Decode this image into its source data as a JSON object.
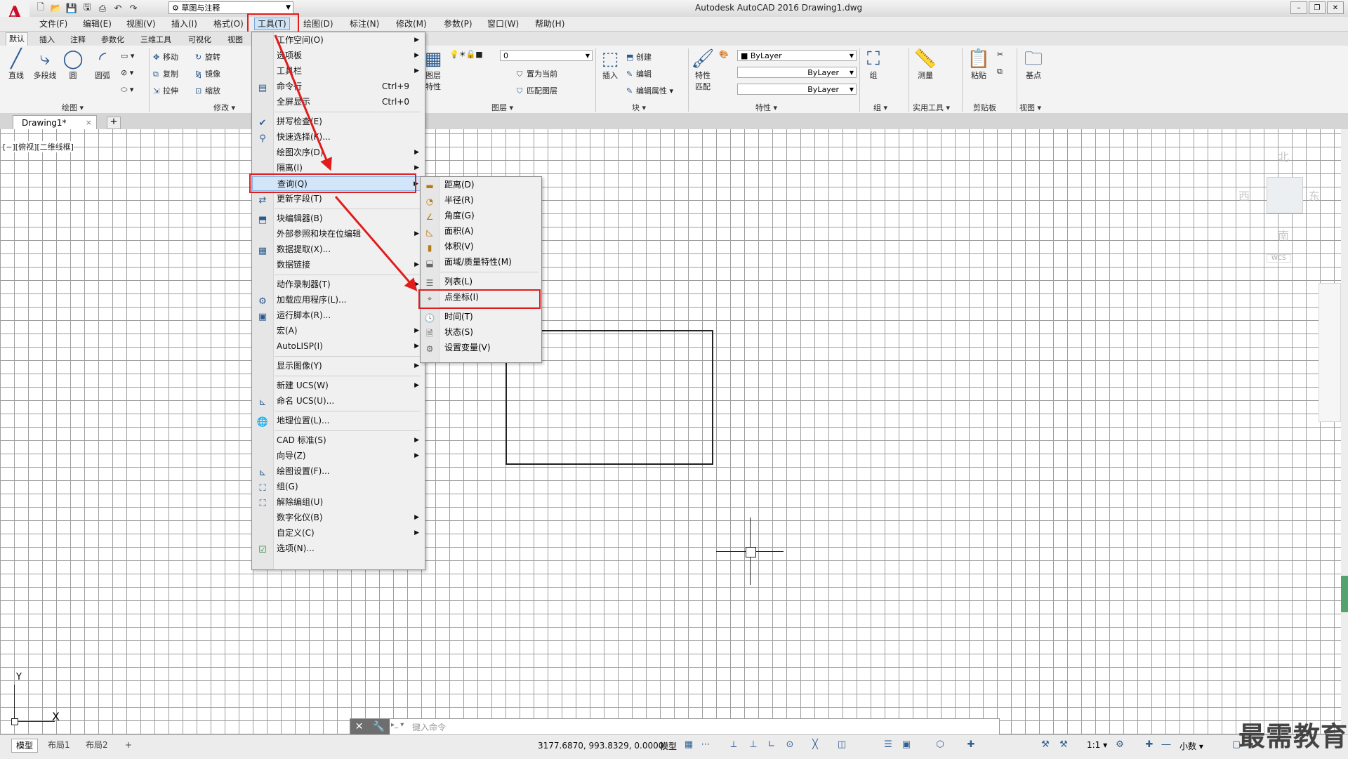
{
  "window": {
    "title": "Autodesk AutoCAD 2016    Drawing1.dwg",
    "logo": "A",
    "workspace": "草图与注释",
    "controls": [
      "–",
      "❐",
      "✕"
    ]
  },
  "qat": {
    "icons": [
      "new-icon",
      "open-icon",
      "save-icon",
      "saveas-icon",
      "print-icon",
      "undo-icon",
      "redo-icon"
    ]
  },
  "menubar": {
    "items": [
      "文件(F)",
      "编辑(E)",
      "视图(V)",
      "插入(I)",
      "格式(O)",
      "工具(T)",
      "绘图(D)",
      "标注(N)",
      "修改(M)",
      "参数(P)",
      "窗口(W)",
      "帮助(H)"
    ]
  },
  "ribbon": {
    "tabs": [
      "默认",
      "插入",
      "注释",
      "参数化",
      "三维工具",
      "可视化",
      "视图"
    ],
    "draw": {
      "line": "直线",
      "polyline": "多段线",
      "circle": "圆",
      "arc": "圆弧",
      "panel": "绘图"
    },
    "modify": {
      "move": "移动",
      "rotate": "旋转",
      "copy": "复制",
      "mirror": "镜像",
      "stretch": "拉伸",
      "scale": "缩放",
      "panel": "修改"
    },
    "layers": {
      "properties": "图层\n特性",
      "current_layer": "0",
      "set_current": "置为当前",
      "match_layer": "匹配图层",
      "panel": "图层"
    },
    "block": {
      "insert": "插入",
      "create": "创建",
      "edit": "编辑",
      "edit_attr": "编辑属性",
      "panel": "块"
    },
    "properties": {
      "match": "特性\n匹配",
      "color": "ByLayer",
      "linetype": "ByLayer",
      "lineweight": "ByLayer",
      "panel": "特性"
    },
    "groups": {
      "group": "组",
      "panel": "组"
    },
    "utilities": {
      "measure": "测量",
      "panel": "实用工具"
    },
    "clipboard": {
      "paste": "粘贴",
      "panel": "剪贴板"
    },
    "view": {
      "base": "基点",
      "panel": "视图"
    }
  },
  "doc_tab": {
    "name": "Drawing1*",
    "close": "×",
    "new": "+"
  },
  "viewport_label": "[−][俯视][二维线框]",
  "viewcube": {
    "north": "北",
    "south": "南",
    "east": "东",
    "west": "西",
    "wcs": "WCS"
  },
  "ucs": {
    "x": "X",
    "y": "Y"
  },
  "tools_menu": {
    "items": [
      {
        "label": "工作空间(O)",
        "submenu": true
      },
      {
        "label": "选项板",
        "submenu": true
      },
      {
        "label": "工具栏",
        "submenu": true
      },
      {
        "label": "命令行",
        "shortcut": "Ctrl+9"
      },
      {
        "label": "全屏显示",
        "shortcut": "Ctrl+0"
      },
      {
        "label": "拼写检查(E)"
      },
      {
        "label": "快速选择(K)..."
      },
      {
        "label": "绘图次序(D)",
        "submenu": true
      },
      {
        "label": "隔离(I)",
        "submenu": true
      },
      {
        "label": "查询(Q)",
        "submenu": true
      },
      {
        "label": "更新字段(T)"
      },
      {
        "label": "块编辑器(B)"
      },
      {
        "label": "外部参照和块在位编辑",
        "submenu": true
      },
      {
        "label": "数据提取(X)..."
      },
      {
        "label": "数据链接",
        "submenu": true
      },
      {
        "label": "动作录制器(T)",
        "submenu": true
      },
      {
        "label": "加载应用程序(L)..."
      },
      {
        "label": "运行脚本(R)..."
      },
      {
        "label": "宏(A)",
        "submenu": true
      },
      {
        "label": "AutoLISP(I)",
        "submenu": true
      },
      {
        "label": "显示图像(Y)",
        "submenu": true
      },
      {
        "label": "新建 UCS(W)",
        "submenu": true
      },
      {
        "label": "命名 UCS(U)..."
      },
      {
        "label": "地理位置(L)..."
      },
      {
        "label": "CAD 标准(S)",
        "submenu": true
      },
      {
        "label": "向导(Z)",
        "submenu": true
      },
      {
        "label": "绘图设置(F)..."
      },
      {
        "label": "组(G)"
      },
      {
        "label": "解除编组(U)"
      },
      {
        "label": "数字化仪(B)",
        "submenu": true
      },
      {
        "label": "自定义(C)",
        "submenu": true
      },
      {
        "label": "选项(N)..."
      }
    ]
  },
  "inquiry_menu": {
    "items": [
      "距离(D)",
      "半径(R)",
      "角度(G)",
      "面积(A)",
      "体积(V)",
      "面域/质量特性(M)",
      "列表(L)",
      "点坐标(I)",
      "时间(T)",
      "状态(S)",
      "设置变量(V)"
    ]
  },
  "command_line": {
    "placeholder": "键入命令"
  },
  "layout_tabs": [
    "模型",
    "布局1",
    "布局2",
    "+"
  ],
  "status": {
    "coords": "3177.6870, 993.8329, 0.0000",
    "space": "模型",
    "scale": "1:1",
    "units": "小数"
  },
  "watermark": "最需教育",
  "colors": {
    "highlight": "#e01d1d",
    "menu_hover": "#d3e5f8",
    "grid": "#9e9e9e",
    "logo": "#c8102e"
  }
}
